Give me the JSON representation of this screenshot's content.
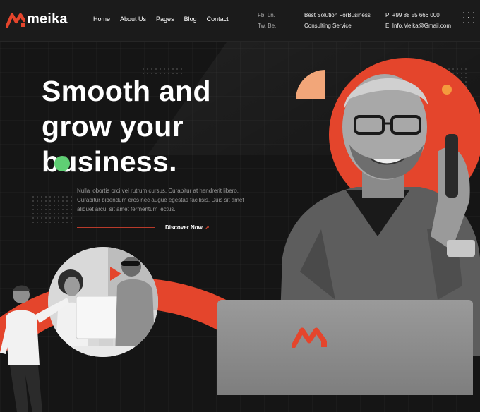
{
  "brand": {
    "name": "meika",
    "accent": "#e4452c",
    "accent_light": "#f2a679",
    "green": "#5fcf74"
  },
  "nav": {
    "items": [
      "Home",
      "About Us",
      "Pages",
      "Blog",
      "Contact"
    ]
  },
  "social": {
    "facebook": "Fb. Ln.",
    "twitter": "Tw. Be."
  },
  "tagline": {
    "line1": "Best Solution ForBusiness",
    "line2": "Consulting Service"
  },
  "contact": {
    "phone": "P: +99 88 55 666 000",
    "email": "E: Info.Meika@Gmail.com"
  },
  "hero": {
    "headline_1": "Smooth and",
    "headline_2": "grow your",
    "headline_3": "business.",
    "body_1": "Nulla lobortis orci vel rutrum cursus. Curabitur at hendrerit libero.",
    "body_2": "Curabitur bibendum eros nec augue egestas facilisis. Duis sit amet",
    "body_3": "aliquet arcu, sit amet fermentum lectus.",
    "cta": "Discover Now",
    "cta_icon": "arrow-up-right-icon"
  }
}
